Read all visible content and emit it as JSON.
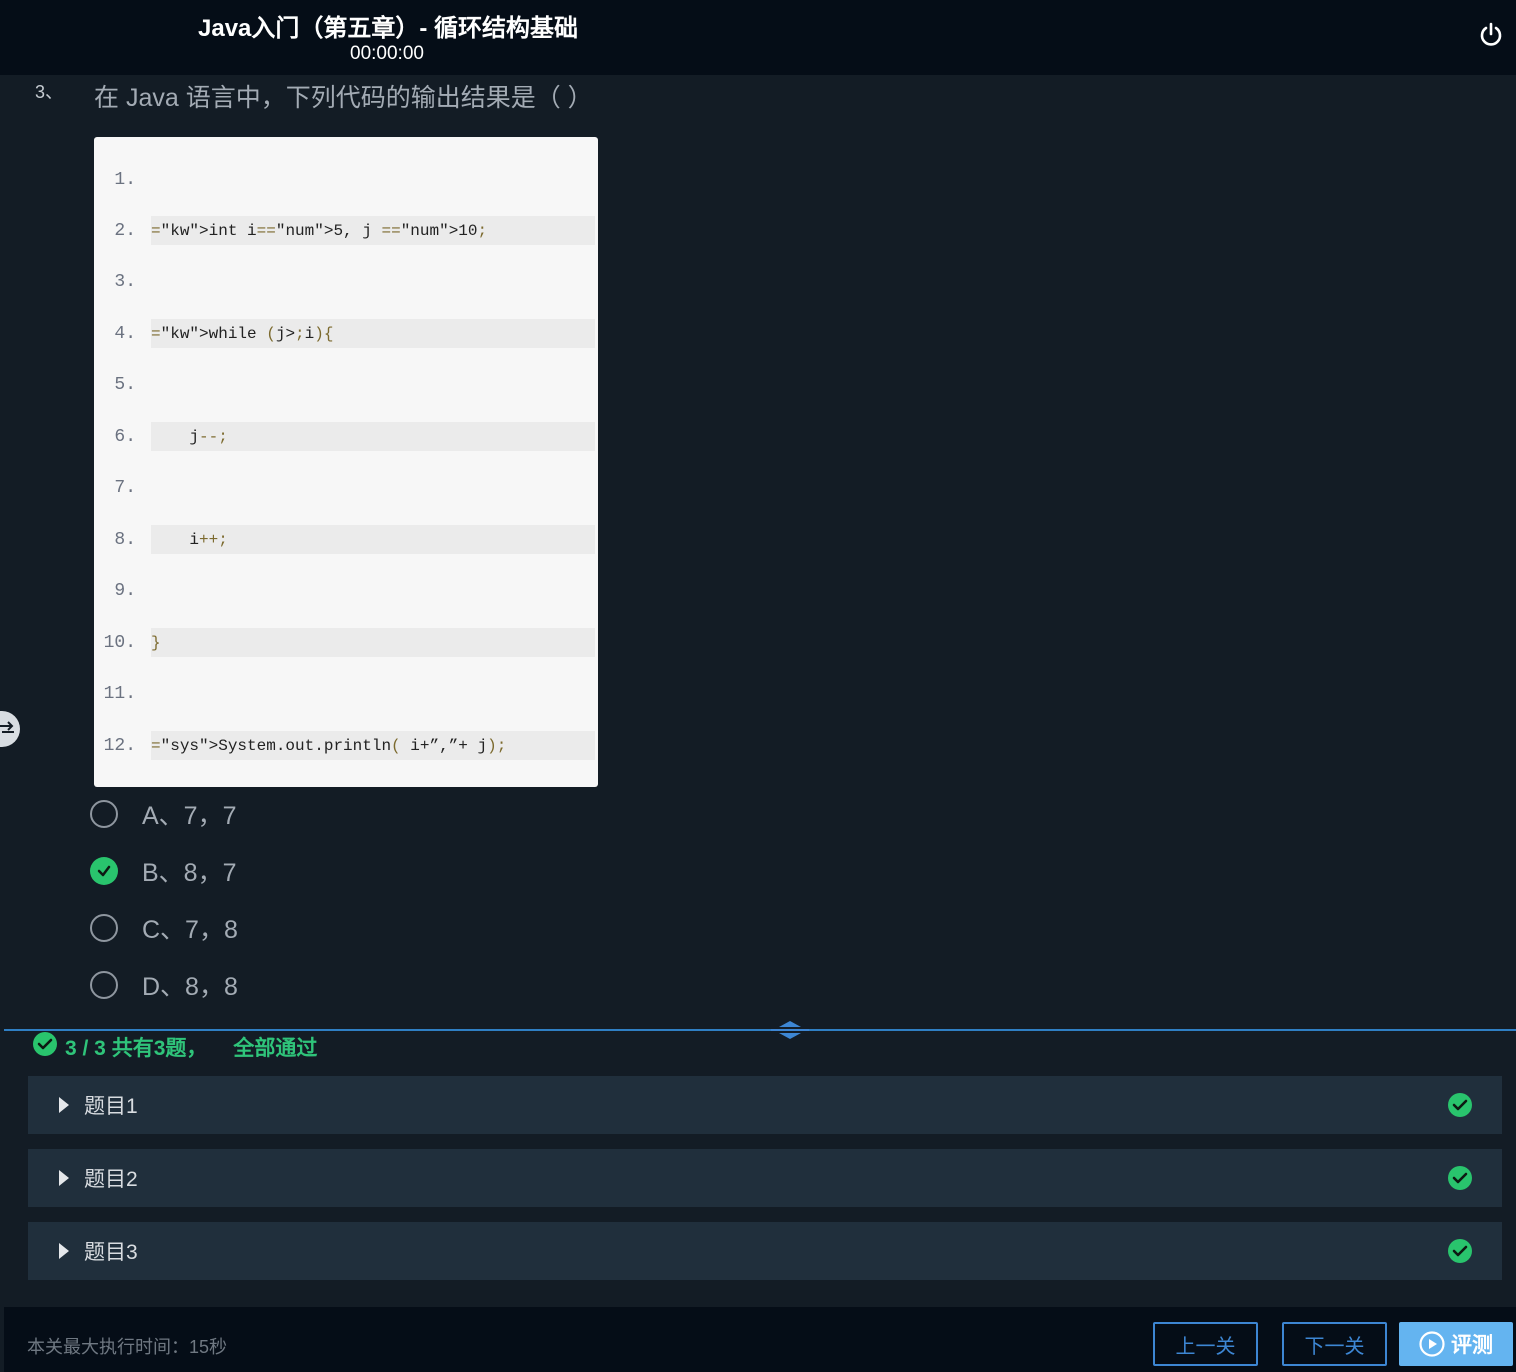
{
  "header": {
    "title": "Java入门（第五章）- 循环结构基础",
    "timer": "00:00:00"
  },
  "question": {
    "number": "3、",
    "text": "在 Java 语言中，下列代码的输出结果是（  ）",
    "code_lines": [
      {
        "num": "1.",
        "code": ""
      },
      {
        "num": "2.",
        "code": "int i= 5, j = 10;"
      },
      {
        "num": "3.",
        "code": ""
      },
      {
        "num": "4.",
        "code": "while (j>i) {"
      },
      {
        "num": "5.",
        "code": ""
      },
      {
        "num": "6.",
        "code": "    j--;"
      },
      {
        "num": "7.",
        "code": ""
      },
      {
        "num": "8.",
        "code": "    i++;"
      },
      {
        "num": "9.",
        "code": ""
      },
      {
        "num": "10.",
        "code": "}"
      },
      {
        "num": "11.",
        "code": ""
      },
      {
        "num": "12.",
        "code": "System.out.println( i+”,”+ j);"
      }
    ],
    "options": [
      {
        "label": "A、7，7",
        "selected": false
      },
      {
        "label": "B、8，7",
        "selected": true
      },
      {
        "label": "C、7，8",
        "selected": false
      },
      {
        "label": "D、8，8",
        "selected": false
      }
    ]
  },
  "results": {
    "score": "3 / 3 共有3题，",
    "status": "全部通过",
    "items": [
      {
        "label": "题目1",
        "passed": true
      },
      {
        "label": "题目2",
        "passed": true
      },
      {
        "label": "题目3",
        "passed": true
      }
    ]
  },
  "footer": {
    "limit": "本关最大执行时间：15秒",
    "prev_label": "上一关",
    "next_label": "下一关",
    "evaluate_label": "评测"
  },
  "colors": {
    "accent": "#3d86d3",
    "success": "#29c46d",
    "header_bg": "#050d17",
    "page_bg": "#131c25"
  },
  "icons": [
    "power-icon",
    "check-circle-icon",
    "caret-right-icon",
    "play-circle-icon",
    "resize-handle-icon",
    "swap-icon"
  ]
}
